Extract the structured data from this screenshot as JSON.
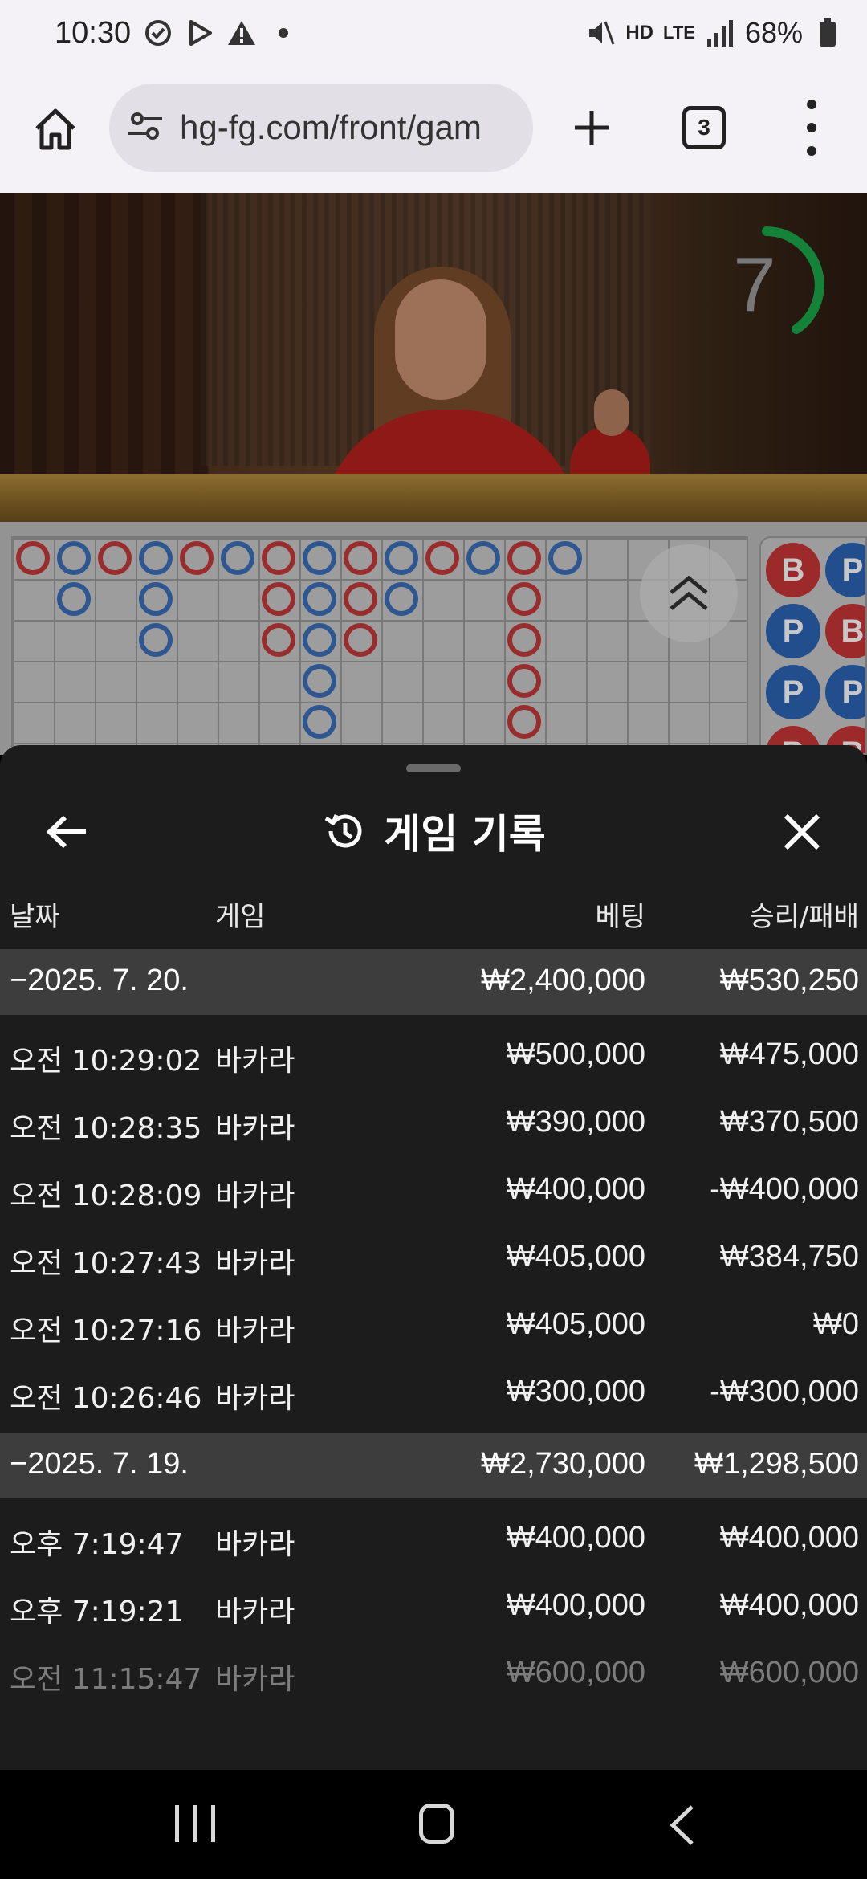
{
  "status_bar": {
    "time": "10:30",
    "battery": "68%",
    "network": "LTE",
    "voice": "HD"
  },
  "browser": {
    "url": "hg-fg.com/front/gam",
    "tab_count": "3"
  },
  "game": {
    "countdown": "7"
  },
  "bead_plate": [
    "B",
    "P",
    "P",
    "B",
    "P",
    "B",
    "P",
    "B"
  ],
  "history_sheet": {
    "title": "게임 기록",
    "columns": {
      "date": "날짜",
      "game": "게임",
      "bet": "베팅",
      "win_loss": "승리/패배"
    },
    "groups": [
      {
        "date": "−2025. 7. 20.",
        "bet_total": "₩2,400,000",
        "result_total": "₩530,250",
        "rows": [
          {
            "time": "오전 10:29:02",
            "game": "바카라",
            "bet": "₩500,000",
            "result": "₩475,000"
          },
          {
            "time": "오전 10:28:35",
            "game": "바카라",
            "bet": "₩390,000",
            "result": "₩370,500"
          },
          {
            "time": "오전 10:28:09",
            "game": "바카라",
            "bet": "₩400,000",
            "result": "-₩400,000"
          },
          {
            "time": "오전 10:27:43",
            "game": "바카라",
            "bet": "₩405,000",
            "result": "₩384,750"
          },
          {
            "time": "오전 10:27:16",
            "game": "바카라",
            "bet": "₩405,000",
            "result": "₩0"
          },
          {
            "time": "오전 10:26:46",
            "game": "바카라",
            "bet": "₩300,000",
            "result": "-₩300,000"
          }
        ]
      },
      {
        "date": "−2025. 7. 19.",
        "bet_total": "₩2,730,000",
        "result_total": "₩1,298,500",
        "rows": [
          {
            "time": "오후 7:19:47",
            "game": "바카라",
            "bet": "₩400,000",
            "result": "₩400,000"
          },
          {
            "time": "오후 7:19:21",
            "game": "바카라",
            "bet": "₩400,000",
            "result": "₩400,000"
          },
          {
            "time": "오전 11:15:47",
            "game": "바카라",
            "bet": "₩600,000",
            "result": "₩600,000"
          }
        ]
      }
    ]
  },
  "colors": {
    "banker": "#c43a3a",
    "player": "#3c6fb9",
    "timer": "#1aa84a",
    "sheet_bg": "#1c1c1c",
    "group_bg": "#3d3d3d"
  }
}
